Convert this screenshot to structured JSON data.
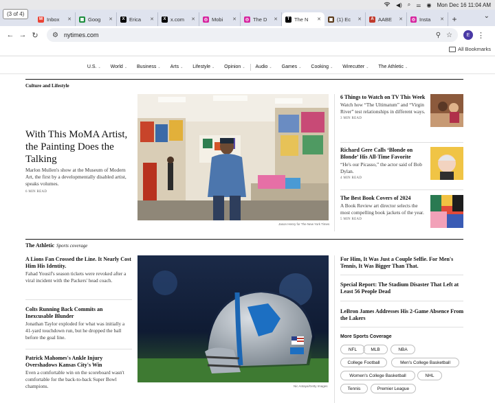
{
  "menubar": {
    "datetime": "Mon Dec 16  11:04 AM"
  },
  "tab_counter": "(3 of 4)",
  "tabs": [
    {
      "label": "Inbox",
      "color": "#ea4335",
      "glyph": "M"
    },
    {
      "label": "Goog",
      "color": "#1e8e3e",
      "glyph": "▦"
    },
    {
      "label": "Erica",
      "color": "#000000",
      "glyph": "X"
    },
    {
      "label": "x.com",
      "color": "#000000",
      "glyph": "X"
    },
    {
      "label": "Mobi",
      "color": "#d6249f",
      "glyph": "◎"
    },
    {
      "label": "The D",
      "color": "#d6249f",
      "glyph": "◎"
    },
    {
      "label": "The N",
      "color": "#000000",
      "glyph": "T",
      "active": true
    },
    {
      "label": "(1) Ec",
      "color": "#5a3a1a",
      "glyph": "▣"
    },
    {
      "label": "AABE",
      "color": "#c0392b",
      "glyph": "A"
    },
    {
      "label": "Insta",
      "color": "#d6249f",
      "glyph": "◎"
    }
  ],
  "address": {
    "url": "nytimes.com",
    "profile_initial": "E"
  },
  "bookmarks": {
    "all_label": "All Bookmarks"
  },
  "nav": [
    "U.S.",
    "World",
    "Business",
    "Arts",
    "Lifestyle",
    "Opinion",
    "Audio",
    "Games",
    "Cooking",
    "Wirecutter",
    "The Athletic"
  ],
  "culture": {
    "section_label": "Culture and Lifestyle",
    "lead": {
      "headline": "With This MoMA Artist, the Painting Does the Talking",
      "summary": "Marlon Mullen's show at the Museum of Modern Art, the first by a developmentally disabled artist, speaks volumes.",
      "read_time": "6 MIN READ",
      "photo_credit": "Jason Henry for The New York Times"
    },
    "side": [
      {
        "headline": "6 Things to Watch on TV This Week",
        "summary": "Watch how “The Ultimatum” and “Virgin River” test relationships in different ways.",
        "read_time": "3 MIN READ"
      },
      {
        "headline": "Richard Gere Calls ‘Blonde on Blonde’ His All-Time Favorite",
        "summary": "“He's our Picasso,” the actor said of Bob Dylan.",
        "read_time": "4 MIN READ"
      },
      {
        "headline": "The Best Book Covers of 2024",
        "summary": "A Book Review art director selects the most compelling book jackets of the year.",
        "read_time": "5 MIN READ"
      }
    ]
  },
  "athletic": {
    "brand": "The Athletic",
    "sub": "Sports coverage",
    "left": [
      {
        "headline": "A Lions Fan Crossed the Line. It Nearly Cost Him His Identity.",
        "summary": "Fahad Yousif's season tickets were revoked after a viral incident with the Packers' head coach."
      },
      {
        "headline": "Colts Running Back Commits an Inexcusable Blunder",
        "summary": "Jonathan Taylor exploded for what was initially a 41-yard touchdown run, but he dropped the ball before the goal line."
      },
      {
        "headline": "Patrick Mahomes's Ankle Injury Overshadows Kansas City's Win",
        "summary": "Even a comfortable win on the scoreboard wasn't comfortable for the back-to-back Super Bowl champions."
      }
    ],
    "photo_credit": "Nic Antaya/Getty Images",
    "right": [
      {
        "headline": "For Him, It Was Just a Couple Selfie. For Men's Tennis, It Was Bigger Than That."
      },
      {
        "headline": "Special Report: The Stadium Disaster That Left at Least 56 People Dead"
      },
      {
        "headline": "LeBron James Addresses His 2-Game Absence From the Lakers"
      }
    ],
    "more_label": "More Sports Coverage",
    "pills": [
      "NFL",
      "MLB",
      "NBA",
      "College Football",
      "Men's College Basketball",
      "Women's College Basketball",
      "NHL",
      "Tennis",
      "Premier League"
    ]
  }
}
